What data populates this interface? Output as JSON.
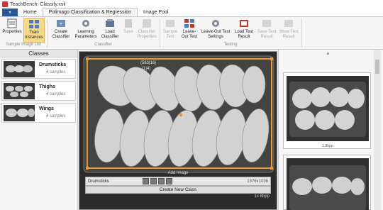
{
  "window": {
    "title": "TeachBench: Classify.xsil"
  },
  "ribbon_tabs": [
    {
      "label": "Home"
    },
    {
      "label": "Polimago Classification & Regression"
    },
    {
      "label": "Image Pool"
    }
  ],
  "ribbon": {
    "buttons": {
      "properties": "Properties",
      "train_instances": "Train Instances",
      "create_classifier": "Create Classifier",
      "learning_parameters": "Learning Parameters",
      "load_classifier": "Load Classifier",
      "save": "Save",
      "classifier_properties": "Classifier Properties",
      "sample_test": "Sample Test",
      "leave_out_test": "Leave-Out Test",
      "leave_out_test_settings": "Leave-Out Test Settings",
      "load_test_result": "Load Test Result",
      "save_test_result": "Save Test Result",
      "show_test_result": "Show Test Result"
    },
    "groups": {
      "sample_image_list": "Sample Image List",
      "classifier": "Classifier",
      "testing": "Testing"
    }
  },
  "classes_panel": {
    "header": "Classes",
    "items": [
      {
        "name": "Drumsticks",
        "count": "4 samples"
      },
      {
        "name": "Thighs",
        "count": "4 samples"
      },
      {
        "name": "Wings",
        "count": "4 samples"
      }
    ]
  },
  "viewer": {
    "roi_position": "(563|16)",
    "roi_size": "(1|4)",
    "add_image": "Add Image",
    "class_name": "Drumsticks",
    "image_size": "1376x1036",
    "create_class": "Create New Class",
    "zoom": "1x 8bpp"
  },
  "image_pool": {
    "items": [
      {
        "size": "1,8bpp"
      },
      {
        "size": ""
      }
    ]
  },
  "colors": {
    "roi": "#e89a2a",
    "selected_button": "#f7d98a",
    "file_tab": "#2b579a"
  }
}
